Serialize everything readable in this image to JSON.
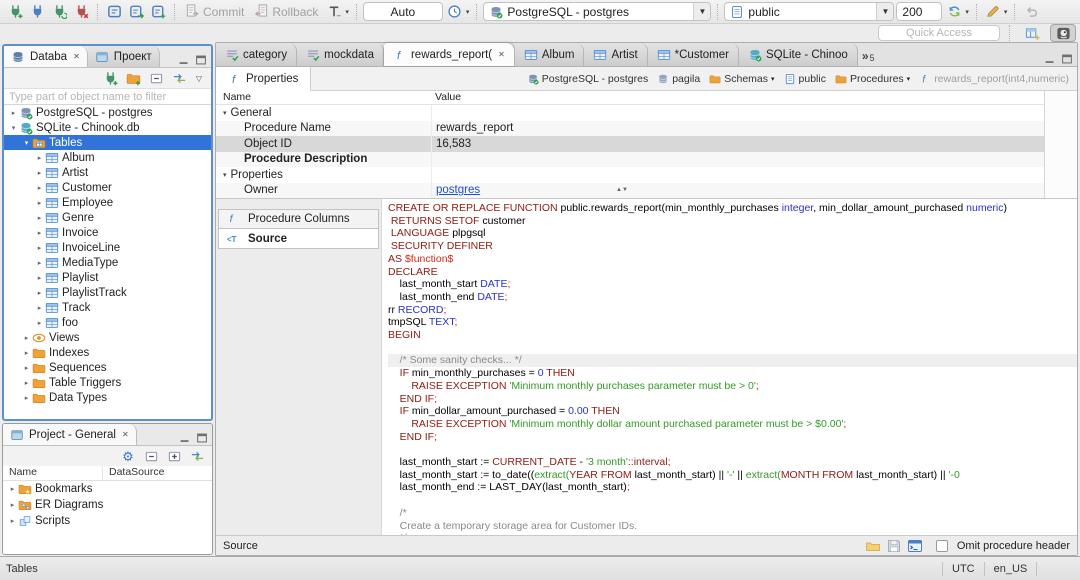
{
  "colors": {
    "selection": "#3273d8",
    "link": "#1a4fd0",
    "keyword": "#8e1a10",
    "string": "#339926",
    "number": "#2830cf",
    "comment": "#8a8a8a"
  },
  "toolbar": {
    "commit_label": "Commit",
    "rollback_label": "Rollback",
    "auto_value": "Auto",
    "connection_value": "PostgreSQL - postgres",
    "schema_value": "public",
    "fetch_size_value": "200",
    "quick_access_placeholder": "Quick Access"
  },
  "database_panel": {
    "tab_database": "Databa",
    "tab_project": "Проект",
    "filter_placeholder": "Type part of object name to filter",
    "tree": [
      {
        "label": "PostgreSQL - postgres",
        "icon": "db-postgres",
        "indent": 0,
        "arrow": "right"
      },
      {
        "label": "SQLite - Chinook.db",
        "icon": "db-sqlite",
        "indent": 0,
        "arrow": "down"
      },
      {
        "label": "Tables",
        "icon": "folder-tables",
        "indent": 1,
        "arrow": "down",
        "selected": true
      },
      {
        "label": "Album",
        "icon": "table",
        "indent": 2,
        "arrow": "right"
      },
      {
        "label": "Artist",
        "icon": "table",
        "indent": 2,
        "arrow": "right"
      },
      {
        "label": "Customer",
        "icon": "table",
        "indent": 2,
        "arrow": "right"
      },
      {
        "label": "Employee",
        "icon": "table",
        "indent": 2,
        "arrow": "right"
      },
      {
        "label": "Genre",
        "icon": "table",
        "indent": 2,
        "arrow": "right"
      },
      {
        "label": "Invoice",
        "icon": "table",
        "indent": 2,
        "arrow": "right"
      },
      {
        "label": "InvoiceLine",
        "icon": "table",
        "indent": 2,
        "arrow": "right"
      },
      {
        "label": "MediaType",
        "icon": "table",
        "indent": 2,
        "arrow": "right"
      },
      {
        "label": "Playlist",
        "icon": "table",
        "indent": 2,
        "arrow": "right"
      },
      {
        "label": "PlaylistTrack",
        "icon": "table",
        "indent": 2,
        "arrow": "right"
      },
      {
        "label": "Track",
        "icon": "table",
        "indent": 2,
        "arrow": "right"
      },
      {
        "label": "foo",
        "icon": "table",
        "indent": 2,
        "arrow": "right"
      },
      {
        "label": "Views",
        "icon": "views",
        "indent": 1,
        "arrow": "right"
      },
      {
        "label": "Indexes",
        "icon": "folder",
        "indent": 1,
        "arrow": "right"
      },
      {
        "label": "Sequences",
        "icon": "folder",
        "indent": 1,
        "arrow": "right"
      },
      {
        "label": "Table Triggers",
        "icon": "folder",
        "indent": 1,
        "arrow": "right"
      },
      {
        "label": "Data Types",
        "icon": "folder",
        "indent": 1,
        "arrow": "right"
      }
    ]
  },
  "project_panel": {
    "title": "Project - General",
    "columns": [
      "Name",
      "DataSource"
    ],
    "items": [
      {
        "label": "Bookmarks",
        "icon": "folder-bookmarks"
      },
      {
        "label": "ER Diagrams",
        "icon": "folder-er"
      },
      {
        "label": "Scripts",
        "icon": "scripts"
      }
    ]
  },
  "editor": {
    "tabs": [
      {
        "label": "category",
        "icon": "script-file"
      },
      {
        "label": "mockdata",
        "icon": "script-file"
      },
      {
        "label": "rewards_report(",
        "icon": "function",
        "active": true
      },
      {
        "label": "Album",
        "icon": "table"
      },
      {
        "label": "Artist",
        "icon": "table"
      },
      {
        "label": "*Customer",
        "icon": "table"
      },
      {
        "label": "SQLite - Chinoo",
        "icon": "db-sqlite"
      }
    ],
    "overflow_count": "5",
    "properties_tab_label": "Properties",
    "breadcrumb": [
      {
        "label": "PostgreSQL - postgres",
        "icon": "db-postgres"
      },
      {
        "label": "pagila",
        "icon": "database"
      },
      {
        "label": "Schemas",
        "icon": "folder",
        "dropdown": true
      },
      {
        "label": "public",
        "icon": "schema"
      },
      {
        "label": "Procedures",
        "icon": "folder",
        "dropdown": true
      },
      {
        "label": "rewards_report(int4,numeric)",
        "icon": "function",
        "muted": true
      }
    ],
    "grid": {
      "columns": [
        "Name",
        "Value"
      ],
      "rows": [
        {
          "name": "General",
          "group": true,
          "value": ""
        },
        {
          "name": "Procedure Name",
          "value": "rewards_report"
        },
        {
          "name": "Object ID",
          "value": "16,583",
          "selected": true
        },
        {
          "name": "Procedure Description",
          "bold": true,
          "value": ""
        },
        {
          "name": "Properties",
          "group": true,
          "value": ""
        },
        {
          "name": "Owner",
          "value": "postgres",
          "link": true
        }
      ]
    },
    "side_tabs": [
      {
        "label": "Procedure Columns",
        "icon": "function"
      },
      {
        "label": "Source",
        "icon": "source",
        "active": true
      }
    ],
    "code": [
      {
        "s": [
          [
            "CREATE OR REPLACE FUNCTION ",
            "k"
          ],
          [
            "public.rewards_report(min_monthly_purchases ",
            "p"
          ],
          [
            "integer",
            "t"
          ],
          [
            ", min_dollar_amount_purchased ",
            "p"
          ],
          [
            "numeric",
            "t"
          ],
          [
            ")",
            "p"
          ]
        ]
      },
      {
        "s": [
          [
            " RETURNS SETOF ",
            "k"
          ],
          [
            "customer",
            "p"
          ]
        ]
      },
      {
        "s": [
          [
            " LANGUAGE ",
            "k"
          ],
          [
            "plpgsql",
            "p"
          ]
        ]
      },
      {
        "s": [
          [
            " SECURITY DEFINER",
            "k"
          ]
        ]
      },
      {
        "s": [
          [
            "AS ",
            "k"
          ],
          [
            "$function$",
            "d"
          ]
        ]
      },
      {
        "s": [
          [
            "DECLARE",
            "k"
          ]
        ]
      },
      {
        "s": [
          [
            "    last_month_start ",
            "p"
          ],
          [
            "DATE",
            "t"
          ],
          [
            ";",
            "s"
          ]
        ]
      },
      {
        "s": [
          [
            "    last_month_end ",
            "p"
          ],
          [
            "DATE",
            "t"
          ],
          [
            ";",
            "s"
          ]
        ]
      },
      {
        "s": [
          [
            "rr ",
            "p"
          ],
          [
            "RECORD",
            "t"
          ],
          [
            ";",
            "s"
          ]
        ]
      },
      {
        "s": [
          [
            "tmpSQL ",
            "p"
          ],
          [
            "TEXT",
            "t"
          ],
          [
            ";",
            "s"
          ]
        ]
      },
      {
        "s": [
          [
            "BEGIN",
            "k"
          ]
        ]
      },
      {
        "s": []
      },
      {
        "hl": true,
        "s": [
          [
            "    /* Some sanity checks... */",
            "c"
          ]
        ]
      },
      {
        "s": [
          [
            "    IF ",
            "k"
          ],
          [
            "min_monthly_purchases = ",
            "p"
          ],
          [
            "0",
            "n"
          ],
          [
            " THEN",
            "k"
          ]
        ]
      },
      {
        "s": [
          [
            "        RAISE EXCEPTION ",
            "k"
          ],
          [
            "'Minimum monthly purchases parameter must be > 0'",
            "g"
          ],
          [
            ";",
            "s"
          ]
        ]
      },
      {
        "s": [
          [
            "    END IF",
            "k"
          ],
          [
            ";",
            "s"
          ]
        ]
      },
      {
        "s": [
          [
            "    IF ",
            "k"
          ],
          [
            "min_dollar_amount_purchased = ",
            "p"
          ],
          [
            "0.00",
            "n"
          ],
          [
            " THEN",
            "k"
          ]
        ]
      },
      {
        "s": [
          [
            "        RAISE EXCEPTION ",
            "k"
          ],
          [
            "'Minimum monthly dollar amount purchased parameter must be > $0.00'",
            "g"
          ],
          [
            ";",
            "s"
          ]
        ]
      },
      {
        "s": [
          [
            "    END IF",
            "k"
          ],
          [
            ";",
            "s"
          ]
        ]
      },
      {
        "s": []
      },
      {
        "s": [
          [
            "    last_month_start := ",
            "p"
          ],
          [
            "CURRENT_DATE",
            "k"
          ],
          [
            " - ",
            "p"
          ],
          [
            "'3 month'",
            "g"
          ],
          [
            "::interval",
            "k"
          ],
          [
            ";",
            "s"
          ]
        ]
      },
      {
        "s": [
          [
            "    last_month_start := to_date((",
            "p"
          ],
          [
            "extract(",
            "g"
          ],
          [
            "YEAR FROM ",
            "k"
          ],
          [
            "last_month_start) || ",
            "p"
          ],
          [
            "'-'",
            "g"
          ],
          [
            " || ",
            "p"
          ],
          [
            "extract(",
            "g"
          ],
          [
            "MONTH FROM ",
            "k"
          ],
          [
            "last_month_start) || ",
            "p"
          ],
          [
            "'-0",
            "g"
          ]
        ]
      },
      {
        "s": [
          [
            "    last_month_end := LAST_DAY(last_month_start)",
            "p"
          ],
          [
            ";",
            "s"
          ]
        ]
      },
      {
        "s": []
      },
      {
        "s": [
          [
            "    /*",
            "c"
          ]
        ]
      },
      {
        "s": [
          [
            "    Create a temporary storage area for Customer IDs.",
            "c"
          ]
        ]
      },
      {
        "s": [
          [
            "    */",
            "c"
          ]
        ]
      }
    ],
    "footer": {
      "label": "Source",
      "omit_label": "Omit procedure header"
    }
  },
  "statusbar": {
    "left": "Tables",
    "timezone": "UTC",
    "locale": "en_US"
  }
}
